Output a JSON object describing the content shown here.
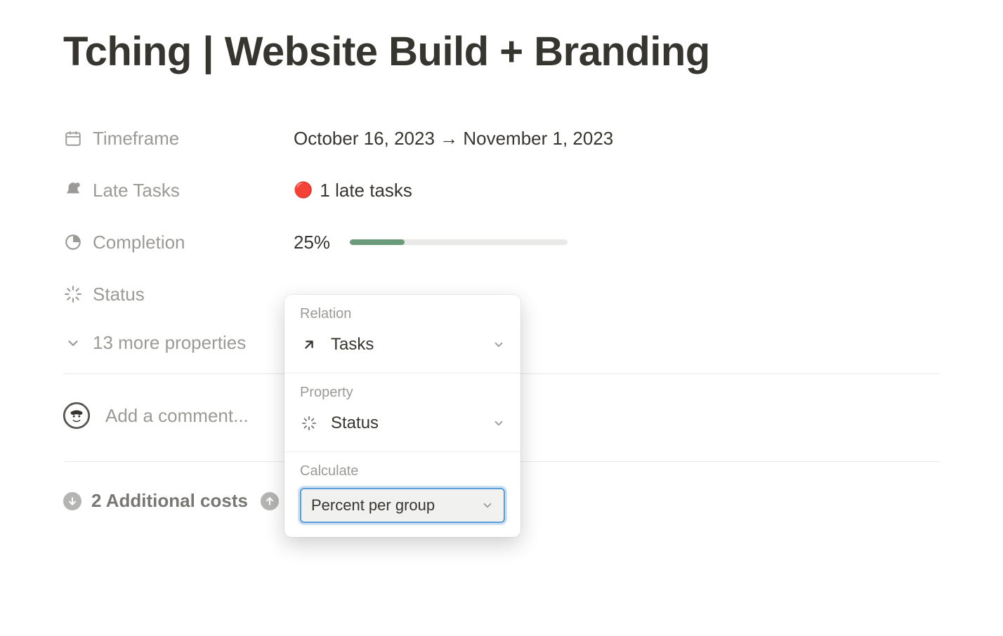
{
  "page": {
    "title": "Tching | Website Build + Branding"
  },
  "properties": {
    "timeframe": {
      "label": "Timeframe",
      "value": "October 16, 2023 → November 1, 2023"
    },
    "lateTasks": {
      "label": "Late Tasks",
      "value": "1 late tasks"
    },
    "completion": {
      "label": "Completion",
      "value": "25%"
    },
    "status": {
      "label": "Status"
    },
    "moreProperties": "13 more properties"
  },
  "comment": {
    "placeholder": "Add a comment..."
  },
  "additional": {
    "label": "2 Additional costs"
  },
  "popover": {
    "relation": {
      "label": "Relation",
      "value": "Tasks"
    },
    "property": {
      "label": "Property",
      "value": "Status"
    },
    "calculate": {
      "label": "Calculate",
      "value": "Percent per group"
    }
  }
}
